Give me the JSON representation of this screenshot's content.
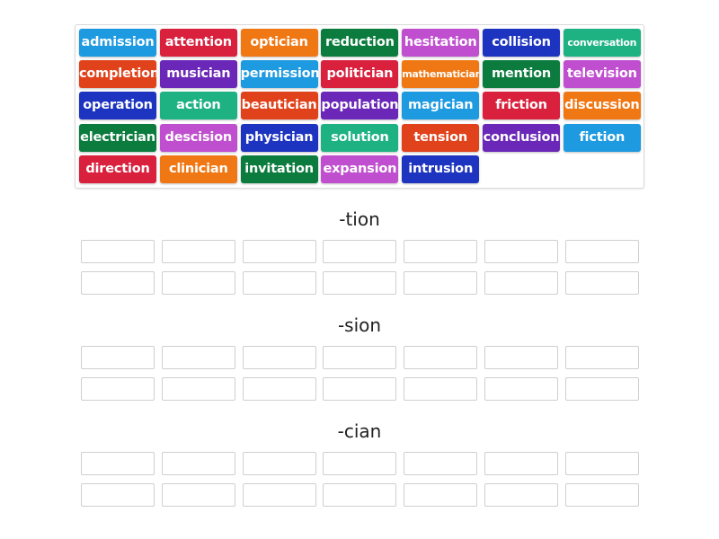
{
  "word_bank": {
    "tiles": [
      {
        "word": "admission",
        "color": "#1e9ae0"
      },
      {
        "word": "attention",
        "color": "#d9203d"
      },
      {
        "word": "optician",
        "color": "#f07814"
      },
      {
        "word": "reduction",
        "color": "#0b7c3e"
      },
      {
        "word": "hesitation",
        "color": "#c04fcf"
      },
      {
        "word": "collision",
        "color": "#1d34c0"
      },
      {
        "word": "conversation",
        "color": "#1eb283",
        "small": true
      },
      {
        "word": "completion",
        "color": "#e0421b"
      },
      {
        "word": "musician",
        "color": "#6a27b8"
      },
      {
        "word": "permission",
        "color": "#1e9ae0"
      },
      {
        "word": "politician",
        "color": "#d9203d"
      },
      {
        "word": "mathematician",
        "color": "#f07814",
        "small": true
      },
      {
        "word": "mention",
        "color": "#0b7c3e"
      },
      {
        "word": "television",
        "color": "#c04fcf"
      },
      {
        "word": "operation",
        "color": "#1d34c0"
      },
      {
        "word": "action",
        "color": "#1eb283"
      },
      {
        "word": "beautician",
        "color": "#e0421b"
      },
      {
        "word": "population",
        "color": "#6a27b8"
      },
      {
        "word": "magician",
        "color": "#1e9ae0"
      },
      {
        "word": "friction",
        "color": "#d9203d"
      },
      {
        "word": "discussion",
        "color": "#f07814"
      },
      {
        "word": "electrician",
        "color": "#0b7c3e"
      },
      {
        "word": "descision",
        "color": "#c04fcf"
      },
      {
        "word": "physician",
        "color": "#1d34c0"
      },
      {
        "word": "solution",
        "color": "#1eb283"
      },
      {
        "word": "tension",
        "color": "#e0421b"
      },
      {
        "word": "conclusion",
        "color": "#6a27b8"
      },
      {
        "word": "fiction",
        "color": "#1e9ae0"
      },
      {
        "word": "direction",
        "color": "#d9203d"
      },
      {
        "word": "clinician",
        "color": "#f07814"
      },
      {
        "word": "invitation",
        "color": "#0b7c3e"
      },
      {
        "word": "expansion",
        "color": "#c04fcf"
      },
      {
        "word": "intrusion",
        "color": "#1d34c0"
      }
    ]
  },
  "categories": [
    {
      "title": "-tion",
      "slot_count": 14
    },
    {
      "title": "-sion",
      "slot_count": 14
    },
    {
      "title": "-cian",
      "slot_count": 14
    }
  ]
}
